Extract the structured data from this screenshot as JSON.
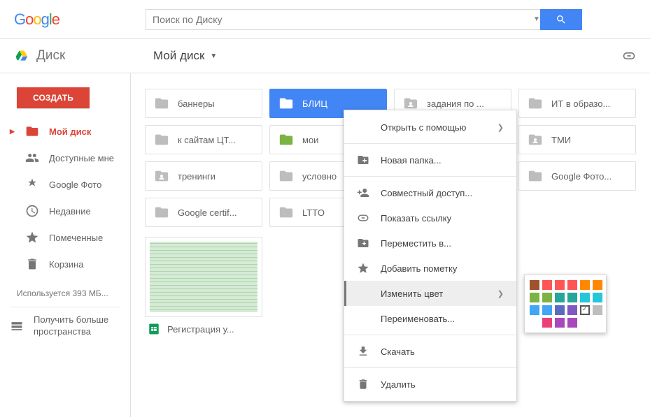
{
  "search": {
    "placeholder": "Поиск по Диску"
  },
  "brand": {
    "name": "Диск"
  },
  "breadcrumb": {
    "label": "Мой диск"
  },
  "sidebar": {
    "create_label": "СОЗДАТЬ",
    "items": [
      {
        "label": "Мой диск"
      },
      {
        "label": "Доступные мне"
      },
      {
        "label": "Google Фото"
      },
      {
        "label": "Недавние"
      },
      {
        "label": "Помеченные"
      },
      {
        "label": "Корзина"
      }
    ],
    "storage_text": "Используется 393 МБ...",
    "more_storage": "Получить больше пространства"
  },
  "folders": [
    {
      "label": "баннеры",
      "type": "plain"
    },
    {
      "label": "БЛИЦ",
      "type": "plain",
      "selected": true
    },
    {
      "label": "задания по ...",
      "type": "shared"
    },
    {
      "label": "ИТ в образо...",
      "type": "plain"
    },
    {
      "label": "к сайтам ЦТ...",
      "type": "plain"
    },
    {
      "label": "мои",
      "type": "green"
    },
    {
      "label": "",
      "type": "hidden"
    },
    {
      "label": "ТМИ",
      "type": "shared"
    },
    {
      "label": "тренинги",
      "type": "shared"
    },
    {
      "label": "условно",
      "type": "plain_partial"
    },
    {
      "label": "",
      "type": "hidden"
    },
    {
      "label": "Google Фото...",
      "type": "plain"
    },
    {
      "label": "Google certif...",
      "type": "plain"
    },
    {
      "label": "LTTO",
      "type": "plain"
    }
  ],
  "file": {
    "label": "Регистрация у..."
  },
  "context_menu": {
    "items": [
      {
        "label": "Открыть с помощью",
        "icon": "none",
        "submenu": true
      },
      {
        "sep": true
      },
      {
        "label": "Новая папка...",
        "icon": "new-folder"
      },
      {
        "sep": true
      },
      {
        "label": "Совместный доступ...",
        "icon": "person-add"
      },
      {
        "label": "Показать ссылку",
        "icon": "link"
      },
      {
        "label": "Переместить в...",
        "icon": "folder-move"
      },
      {
        "label": "Добавить пометку",
        "icon": "star"
      },
      {
        "label": "Изменить цвет",
        "icon": "none",
        "submenu": true,
        "hovered": true
      },
      {
        "label": "Переименовать...",
        "icon": "none"
      },
      {
        "sep": true
      },
      {
        "label": "Скачать",
        "icon": "download"
      },
      {
        "sep": true
      },
      {
        "label": "Удалить",
        "icon": "trash"
      }
    ]
  },
  "color_palette": [
    "#a0522d",
    "#ff5555",
    "#ff5555",
    "#ff5555",
    "#ff8800",
    "#ff8800",
    "#7cb342",
    "#7cb342",
    "#26a69a",
    "#26a69a",
    "#26c6da",
    "#26c6da",
    "#42a5f5",
    "#42a5f5",
    "#5c6bc0",
    "#7e57c2",
    "check",
    "#bdbdbd",
    "",
    "#ec407a",
    "#ab47bc",
    "#ab47bc",
    "",
    ""
  ],
  "chart_data": null
}
